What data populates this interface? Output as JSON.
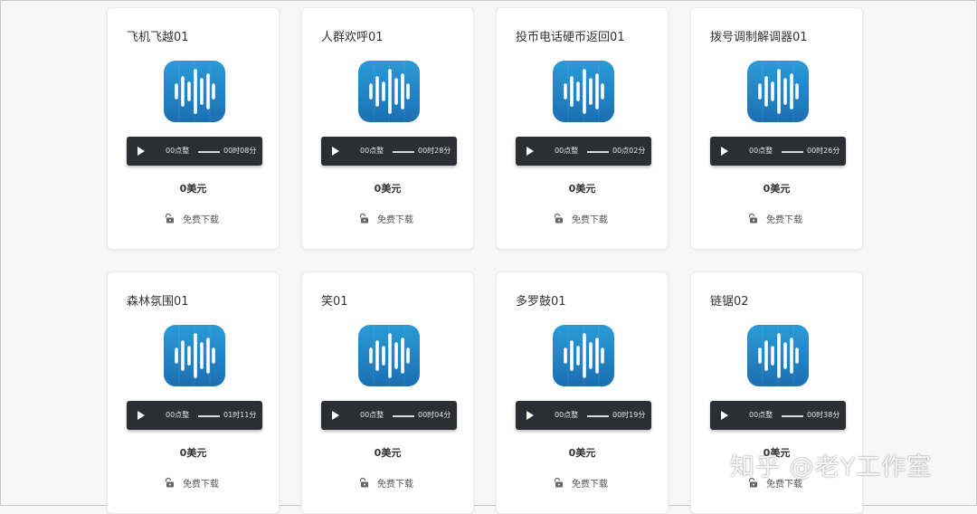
{
  "cards": [
    {
      "title": "飞机飞越01",
      "current_time": "00点整",
      "duration": "00时08分",
      "price": "0美元",
      "download_label": "免费下载"
    },
    {
      "title": "人群欢呼01",
      "current_time": "00点整",
      "duration": "00时28分",
      "price": "0美元",
      "download_label": "免费下载"
    },
    {
      "title": "投币电话硬币返回01",
      "current_time": "00点整",
      "duration": "00点02分",
      "price": "0美元",
      "download_label": "免费下载"
    },
    {
      "title": "拨号调制解调器01",
      "current_time": "00点整",
      "duration": "00时26分",
      "price": "0美元",
      "download_label": "免费下载"
    },
    {
      "title": "森林氛围01",
      "current_time": "00点整",
      "duration": "01时11分",
      "price": "0美元",
      "download_label": "免费下载"
    },
    {
      "title": "笑01",
      "current_time": "00点整",
      "duration": "00时04分",
      "price": "0美元",
      "download_label": "免费下载"
    },
    {
      "title": "多罗鼓01",
      "current_time": "00点整",
      "duration": "00时19分",
      "price": "0美元",
      "download_label": "免费下载"
    },
    {
      "title": "链锯02",
      "current_time": "00点整",
      "duration": "00时38分",
      "price": "0美元",
      "download_label": "免费下载"
    }
  ],
  "watermark": "知乎 @老Y工作室",
  "icons": {
    "sound": "sound-wave-icon",
    "play": "play-icon",
    "download": "unlock-icon"
  },
  "colors": {
    "background": "#f7f7f8",
    "card": "#ffffff",
    "player": "#2b2e33",
    "icon_top": "#2a9bd8",
    "icon_bottom": "#1b6fb2"
  }
}
